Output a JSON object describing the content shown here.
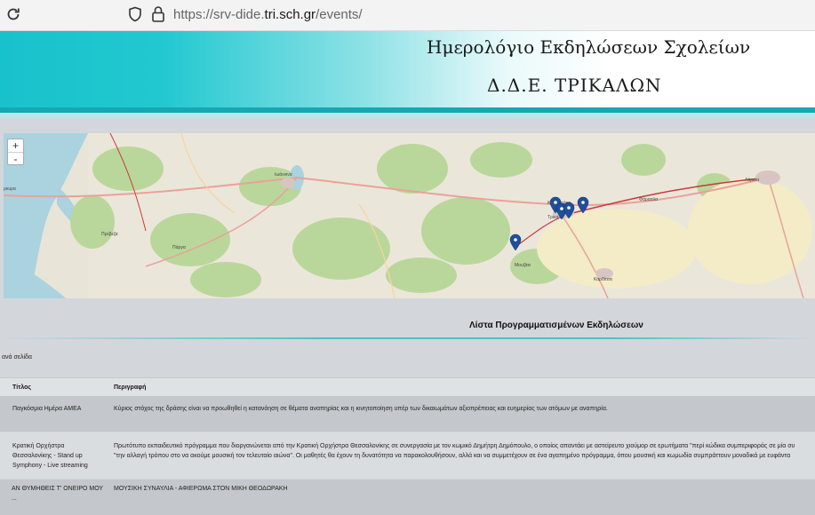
{
  "browser": {
    "url_prefix": "https://srv-dide.",
    "url_host": "tri.sch.gr",
    "url_path": "/events/"
  },
  "header": {
    "title": "Ημερολόγιο Εκδηλώσεων Σχολείων",
    "subtitle": "Δ.Δ.Ε. ΤΡΙΚΑΛΩΝ"
  },
  "map": {
    "zoom_in": "+",
    "zoom_out": "-",
    "labels": {
      "kerkyra": "ρκυρα",
      "ioannina": "Ιωάννινα",
      "trikala": "Τρίκαλα",
      "larisa": "Λάρισα",
      "karditsa": "Καρδίτσα",
      "kalabaka": "Καλαμπάκα",
      "farsala": "Φάρσαλα",
      "parga": "Πάργα",
      "mouzaki": "Μουζάκι",
      "preveza": "Πρέβεζα"
    }
  },
  "list": {
    "title": "Λίστα Προγραμματισμένων Εκδηλώσεων",
    "per_page": "ανά σελίδα",
    "columns": [
      "Τίτλος",
      "Περιγραφή"
    ],
    "rows": [
      {
        "title": "Παγκόσμια Ημέρα ΑΜΕΑ",
        "description": [
          "Κύριος στόχος της δράσης είναι να προωθηθεί η κατανόηση σε θέματα αναπηρίας και η κινητοποίηση υπέρ των δικαιωμάτων αξιοπρέπειας και ευημερίας των ατόμων με αναπηρία."
        ]
      },
      {
        "title": "Κρατική Ορχήστρα Θεσσαλονίκης - Stand up Symphony - Live streaming",
        "description": [
          "Πρωτότυπο εκπαιδευτικό πρόγραμμα που διοργανώνεται από την Κρατική Ορχήστρα Θεσσαλονίκης σε συνεργασία με τον κωμικό Δημήτρη Δημόπουλο, ο οποίος απαντάει με αστείρευτο χιούμορ σε ερωτήματα \"περί κώδικα συμπεριφοράς σε μία συ",
          "\"την αλλαγή τρόπου στο να ακούμε μουσική τον τελευταίο αιώνα\". Οι μαθητές θα έχουν τη δυνατότητα να παρακολουθήσουν, αλλά και να συμμετέχουν σε ένα αγαπημένο πρόγραμμα, όπου μουσική και κωμωδία συμπράττουν μοναδικά με ευφάντα"
        ]
      },
      {
        "title": "ΑΝ ΘΥΜΗΘΕΙΣ Τ' ΟΝΕΙΡΟ ΜΟΥ ...",
        "description": [
          "ΜΟΥΣΙΚΗ ΣΥΝΑΥΛΙΑ - ΑΦΙΕΡΩΜΑ ΣΤΟΝ ΜΙΚΗ ΘΕΟΔΩΡΑΚΗ"
        ]
      }
    ]
  },
  "colors": {
    "header_teal": "#18c2cc",
    "stripe": "#17a7b3",
    "marker": "#1f4f9c",
    "page_bg": "#d3d7dc"
  }
}
